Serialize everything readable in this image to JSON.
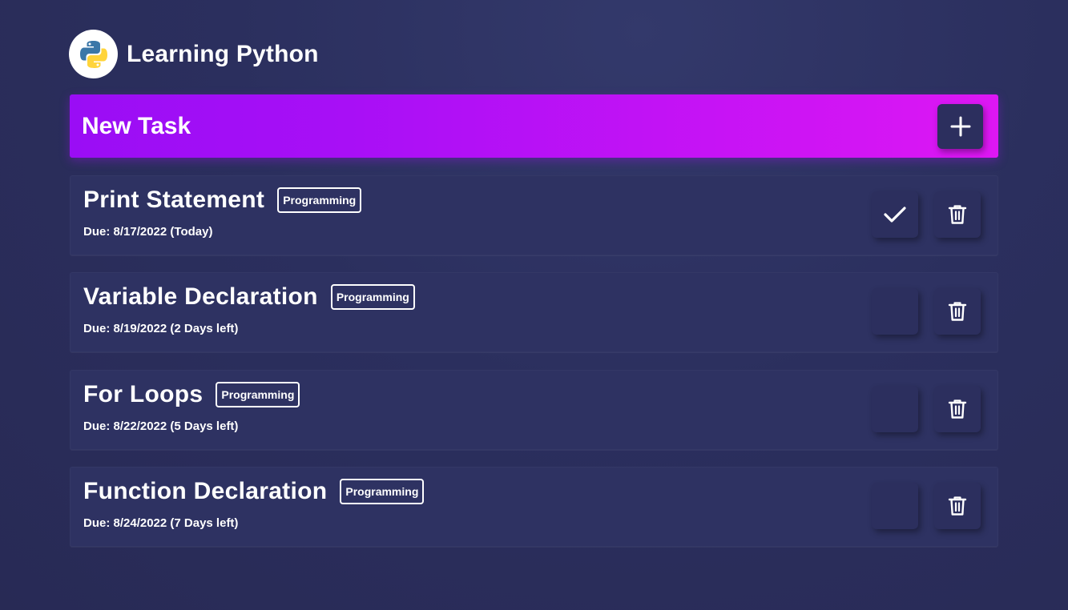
{
  "header": {
    "logo_icon": "python-logo-icon",
    "title": "Learning Python"
  },
  "new_task": {
    "label": "New Task",
    "add_icon": "plus-icon"
  },
  "tasks": [
    {
      "name": "Print Statement",
      "tag": "Programming",
      "due": "Due: 8/17/2022 (Today)",
      "completed": true
    },
    {
      "name": "Variable Declaration",
      "tag": "Programming",
      "due": "Due: 8/19/2022 (2 Days left)",
      "completed": false
    },
    {
      "name": "For Loops",
      "tag": "Programming",
      "due": "Due: 8/22/2022 (5 Days left)",
      "completed": false
    },
    {
      "name": "Function Declaration",
      "tag": "Programming",
      "due": "Due: 8/24/2022 (7 Days left)",
      "completed": false
    }
  ],
  "colors": {
    "background": "#2b2f5e",
    "card": "#2e3262",
    "accent_start": "#9a0df5",
    "accent_end": "#dd17f3"
  }
}
